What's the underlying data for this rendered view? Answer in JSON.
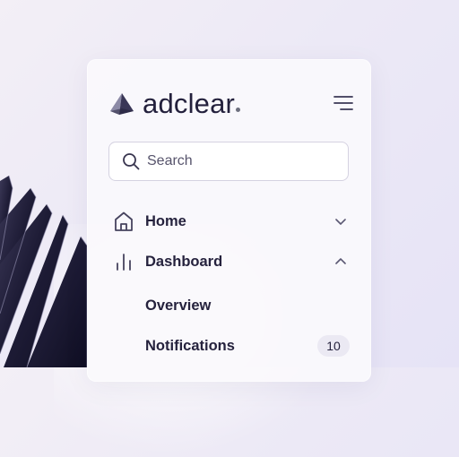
{
  "brand": {
    "name": "adclear",
    "logo_icon": "pyramid-logo-icon"
  },
  "header": {
    "menu_icon": "hamburger-menu-icon"
  },
  "search": {
    "placeholder": "Search",
    "value": "",
    "icon": "search-icon"
  },
  "nav": {
    "items": [
      {
        "label": "Home",
        "icon": "home-icon",
        "expanded": false
      },
      {
        "label": "Dashboard",
        "icon": "bar-chart-icon",
        "expanded": true,
        "children": [
          {
            "label": "Overview"
          },
          {
            "label": "Notifications",
            "badge": "10"
          }
        ]
      }
    ]
  },
  "colors": {
    "text": "#25223d",
    "border": "#d5d2e1",
    "badge_bg": "#ebe9f3",
    "panel_bg": "#faf9fc",
    "deco_dark": "#1c1a33"
  }
}
